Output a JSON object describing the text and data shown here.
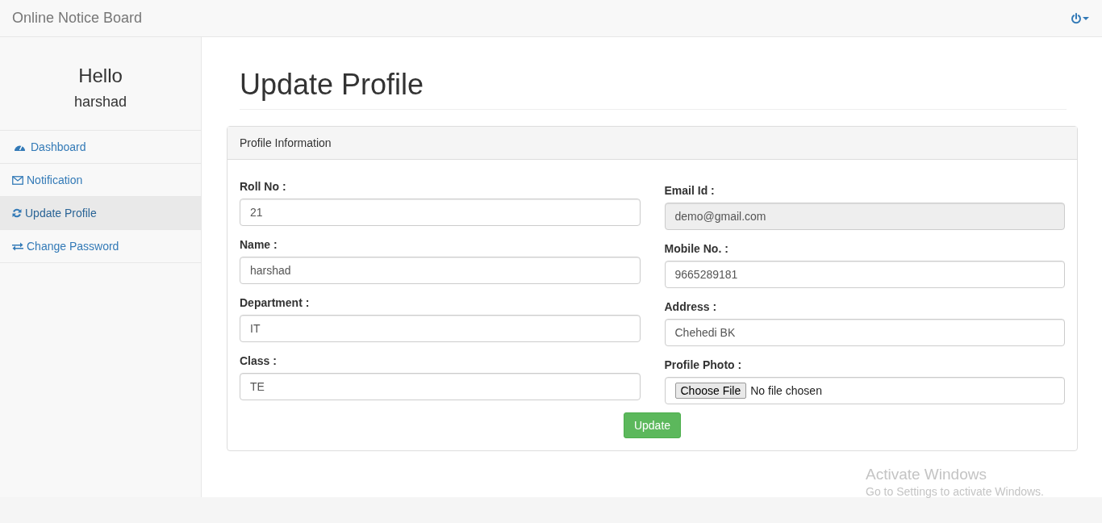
{
  "navbar": {
    "brand": "Online Notice Board"
  },
  "sidebar": {
    "greeting": "Hello",
    "user": "harshad",
    "items": [
      {
        "label": "Dashboard",
        "selected": false
      },
      {
        "label": "Notification",
        "selected": false
      },
      {
        "label": "Update Profile",
        "selected": true
      },
      {
        "label": "Change Password",
        "selected": false
      }
    ]
  },
  "page": {
    "title": "Update Profile"
  },
  "panel": {
    "heading": "Profile Information",
    "left_fields": [
      {
        "kind": "text",
        "label": "Roll No :",
        "value": "21",
        "disabled": false
      },
      {
        "kind": "text",
        "label": "Name :",
        "value": "harshad",
        "disabled": false
      },
      {
        "kind": "text",
        "label": "Department :",
        "value": "IT",
        "disabled": false
      },
      {
        "kind": "text",
        "label": "Class :",
        "value": "TE",
        "disabled": false
      }
    ],
    "right_fields": [
      {
        "kind": "text",
        "label": "Email Id :",
        "value": "demo@gmail.com",
        "disabled": true
      },
      {
        "kind": "text",
        "label": "Mobile No. :",
        "value": "9665289181",
        "disabled": false
      },
      {
        "kind": "text",
        "label": "Address :",
        "value": "Chehedi BK",
        "disabled": false
      },
      {
        "kind": "file",
        "label": "Profile Photo :",
        "button": "Choose File",
        "value": "No file chosen",
        "disabled": false
      }
    ],
    "submit": "Update"
  },
  "os_overlay": {
    "title": "Activate Windows",
    "subtitle": "Go to Settings to activate Windows."
  }
}
